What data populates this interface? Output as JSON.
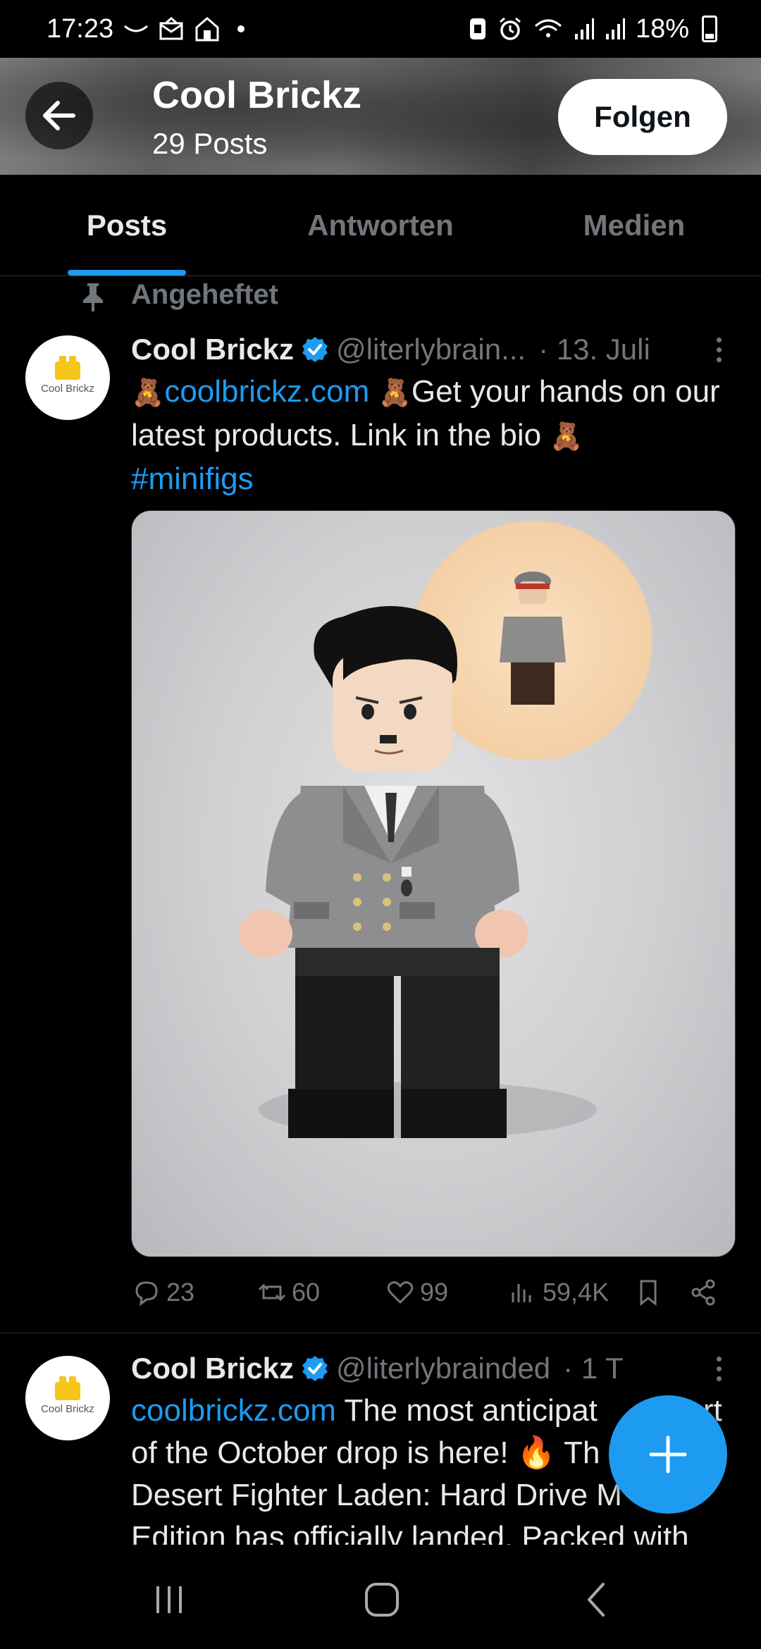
{
  "status_bar": {
    "time": "17:23",
    "battery": "18%",
    "icons": [
      "whatsapp-icon",
      "mail-icon",
      "home-icon",
      "dot-icon",
      "sim-icon",
      "alarm-icon",
      "wifi-icon",
      "signal-icon",
      "signal-icon",
      "battery-icon"
    ]
  },
  "header": {
    "title": "Cool Brickz",
    "subtitle": "29 Posts",
    "follow_label": "Folgen"
  },
  "tabs": [
    {
      "label": "Posts",
      "active": true
    },
    {
      "label": "Antworten",
      "active": false
    },
    {
      "label": "Medien",
      "active": false
    }
  ],
  "pinned": {
    "label": "Angeheftet"
  },
  "avatar_text": "Cool Brickz",
  "posts": [
    {
      "name": "Cool Brickz",
      "handle": "@literlybrain...",
      "time": "· 13. Juli",
      "link": "coolbrickz.com",
      "text_after_link": "Get your hands on our latest products. Link in the bio",
      "hashtag": "#minifigs",
      "emoji": "🧸",
      "stats": {
        "replies": "23",
        "reposts": "60",
        "likes": "99",
        "views": "59,4K"
      }
    },
    {
      "name": "Cool Brickz",
      "handle": "@literlybrainded",
      "time": "· 1 T",
      "link": "coolbrickz.com",
      "text_line1": "The most anticipat",
      "text_line1_end": "rt",
      "text_line2": "of the October drop is here! ",
      "text_line2_emoji": "🔥",
      "text_line2_end": " Th",
      "text_line3": "Desert Fighter Laden: Hard Drive M",
      "text_line4": "Edition has officially landed. Packed with"
    }
  ],
  "colors": {
    "accent": "#1d9bf0",
    "muted": "#71767b",
    "background": "#000000"
  }
}
